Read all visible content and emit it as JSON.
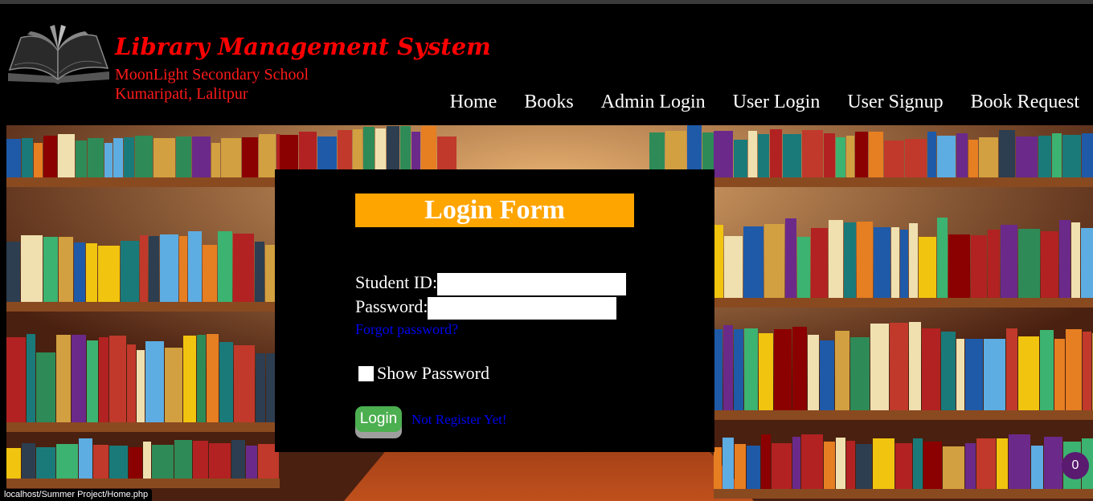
{
  "header": {
    "title": "Library Management System",
    "school": "MoonLight Secondary School",
    "address": "Kumaripati, Lalitpur"
  },
  "nav": {
    "home": "Home",
    "books": "Books",
    "admin_login": "Admin Login",
    "user_login": "User Login",
    "user_signup": "User Signup",
    "book_request": "Book Request"
  },
  "login_form": {
    "title": "Login Form",
    "student_id_label": "Student ID:",
    "student_id_value": "",
    "password_label": "Password:",
    "password_value": "",
    "forgot_password": "Forgot password?",
    "show_password": "Show Password",
    "show_password_checked": false,
    "login_button": "Login",
    "register_link": "Not Register Yet!"
  },
  "status_bar": {
    "url": "localhost/Summer Project/Home.php"
  },
  "notification_badge": {
    "count": "0"
  },
  "colors": {
    "title_red": "#ff0000",
    "form_title_bg": "#ffa500",
    "login_button": "#4caf50",
    "link_blue": "#0000ee",
    "badge_purple": "#5a1a70"
  }
}
